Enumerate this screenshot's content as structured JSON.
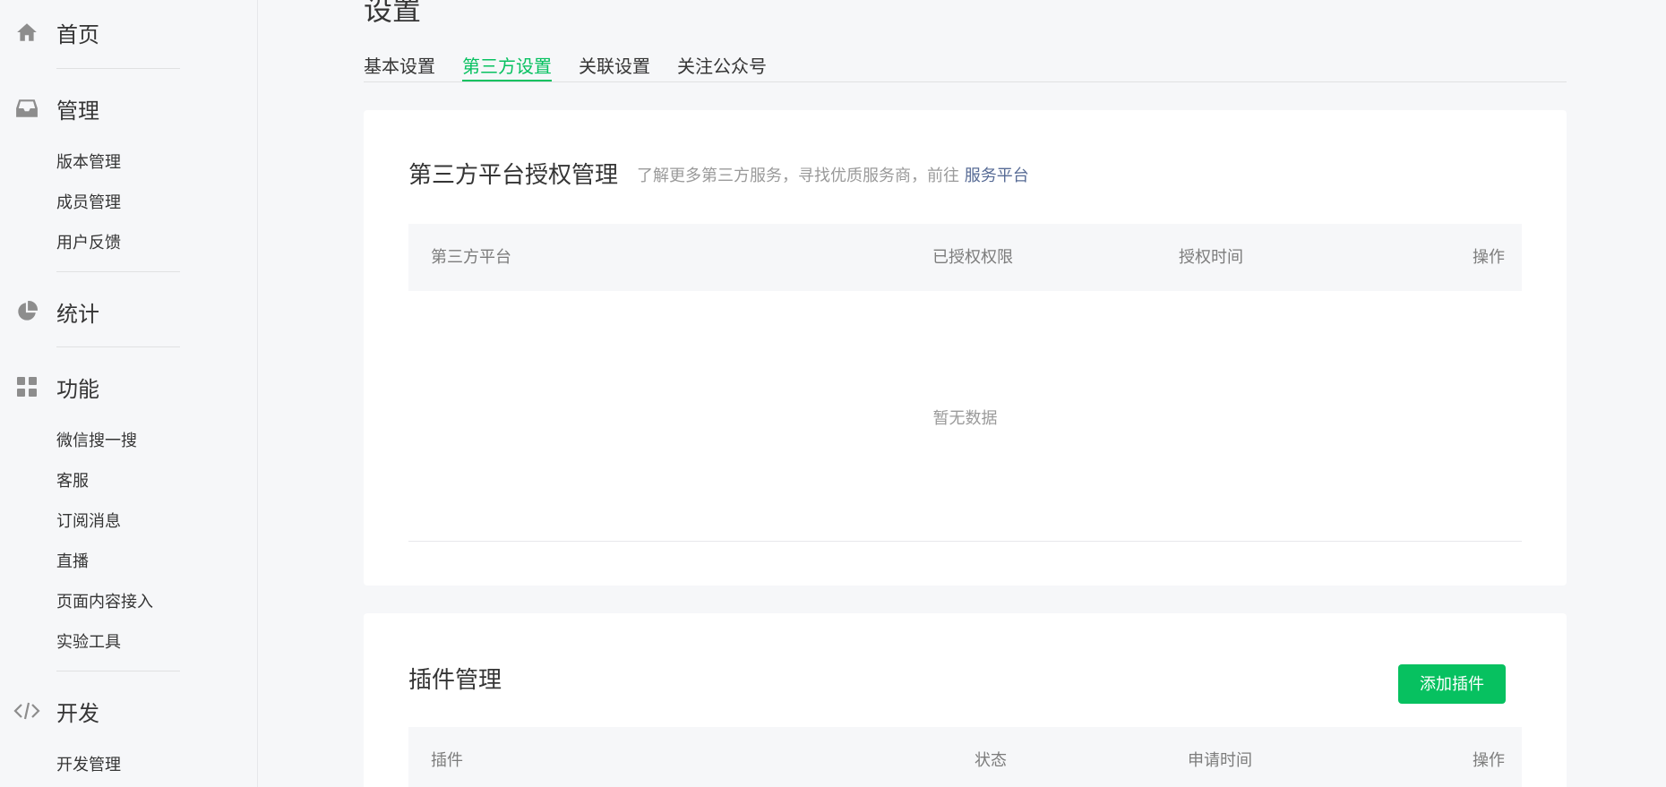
{
  "sidebar": {
    "home": {
      "label": "首页",
      "icon": "home-icon"
    },
    "manage": {
      "label": "管理",
      "icon": "inbox-icon",
      "items": [
        {
          "label": "版本管理"
        },
        {
          "label": "成员管理"
        },
        {
          "label": "用户反馈"
        }
      ]
    },
    "stats": {
      "label": "统计",
      "icon": "pie-chart-icon"
    },
    "features": {
      "label": "功能",
      "icon": "grid-icon",
      "items": [
        {
          "label": "微信搜一搜"
        },
        {
          "label": "客服"
        },
        {
          "label": "订阅消息"
        },
        {
          "label": "直播"
        },
        {
          "label": "页面内容接入"
        },
        {
          "label": "实验工具"
        }
      ]
    },
    "dev": {
      "label": "开发",
      "icon": "code-icon",
      "items": [
        {
          "label": "开发管理"
        }
      ]
    }
  },
  "page": {
    "title": "设置",
    "tabs": [
      {
        "label": "基本设置",
        "active": false
      },
      {
        "label": "第三方设置",
        "active": true
      },
      {
        "label": "关联设置",
        "active": false
      },
      {
        "label": "关注公众号",
        "active": false
      }
    ]
  },
  "auth_card": {
    "title": "第三方平台授权管理",
    "desc": "了解更多第三方服务，寻找优质服务商，前往",
    "desc_link": "服务平台",
    "columns": [
      "第三方平台",
      "已授权权限",
      "授权时间",
      "操作"
    ],
    "empty": "暂无数据"
  },
  "plugin_card": {
    "title": "插件管理",
    "add_button": "添加插件",
    "columns": [
      "插件",
      "状态",
      "申请时间",
      "操作"
    ]
  },
  "colors": {
    "accent": "#07c160",
    "link": "#576b95",
    "bg": "#f6f7f9"
  }
}
